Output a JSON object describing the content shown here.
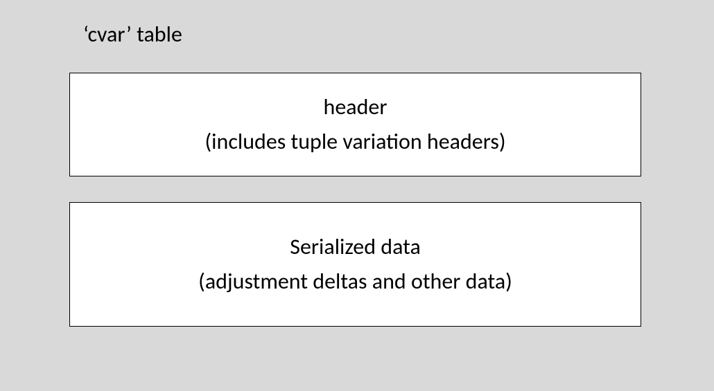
{
  "title": "‘cvar’ table",
  "header_box": {
    "line1": "header",
    "line2": "(includes tuple variation headers)"
  },
  "data_box": {
    "line1": "Serialized data",
    "line2": "(adjustment deltas and other data)"
  }
}
